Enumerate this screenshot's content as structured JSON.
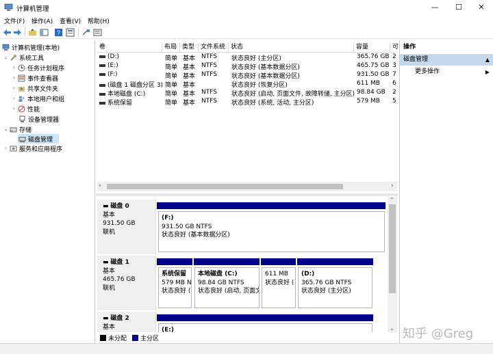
{
  "window": {
    "title": "计算机管理",
    "minimize": "—",
    "maximize": "☐",
    "close": "✕"
  },
  "menu": [
    "文件(F)",
    "操作(A)",
    "查看(V)",
    "帮助(H)"
  ],
  "tree": {
    "root": "计算机管理(本地)",
    "system_tools": "系统工具",
    "items": [
      "任务计划程序",
      "事件查看器",
      "共享文件夹",
      "本地用户和组",
      "性能",
      "设备管理器"
    ],
    "storage": "存储",
    "disk_mgmt": "磁盘管理",
    "services": "服务和应用程序"
  },
  "volumes": {
    "columns": [
      "卷",
      "布局",
      "类型",
      "文件系统",
      "状态",
      "容量",
      "可"
    ],
    "rows": [
      {
        "name": "(D:)",
        "layout": "简单",
        "type": "基本",
        "fs": "NTFS",
        "status": "状态良好 (主分区)",
        "capacity": "365.76 GB",
        "free": "2"
      },
      {
        "name": "(E:)",
        "layout": "简单",
        "type": "基本",
        "fs": "NTFS",
        "status": "状态良好 (基本数据分区)",
        "capacity": "465.75 GB",
        "free": "3"
      },
      {
        "name": "(F:)",
        "layout": "简单",
        "type": "基本",
        "fs": "NTFS",
        "status": "状态良好 (基本数据分区)",
        "capacity": "931.50 GB",
        "free": "7"
      },
      {
        "name": "(磁盘 1 磁盘分区 3)",
        "layout": "简单",
        "type": "基本",
        "fs": "",
        "status": "状态良好 (恢复分区)",
        "capacity": "611 MB",
        "free": "6"
      },
      {
        "name": "本地磁盘 (C:)",
        "layout": "简单",
        "type": "基本",
        "fs": "NTFS",
        "status": "状态良好 (启动, 页面文件, 故障转储, 主分区)",
        "capacity": "98.84 GB",
        "free": "2"
      },
      {
        "name": "系统保留",
        "layout": "简单",
        "type": "基本",
        "fs": "NTFS",
        "status": "状态良好 (系统, 活动, 主分区)",
        "capacity": "579 MB",
        "free": "5"
      }
    ]
  },
  "disks": {
    "d0": {
      "name": "磁盘 0",
      "type": "基本",
      "size": "931.50 GB",
      "state": "联机",
      "p1": {
        "label": "(F:)",
        "size": "931.50 GB NTFS",
        "status": "状态良好 (基本数据分区)"
      }
    },
    "d1": {
      "name": "磁盘 1",
      "type": "基本",
      "size": "465.76 GB",
      "state": "联机",
      "p1": {
        "label": "系统保留",
        "size": "579 MB N",
        "status": "状态良好 ("
      },
      "p2": {
        "label": "本地磁盘 (C:)",
        "size": "98.84 GB NTFS",
        "status": "状态良好 (启动, 页面文"
      },
      "p3": {
        "label": "",
        "size": "611 MB",
        "status": "状态良好 ("
      },
      "p4": {
        "label": "(D:)",
        "size": "365.76 GB NTFS",
        "status": "状态良好 (主分区)"
      }
    },
    "d2": {
      "name": "磁盘 2",
      "type": "基本",
      "p1": {
        "label": "(E:)"
      }
    }
  },
  "legend": {
    "unallocated": "未分配",
    "primary": "主分区"
  },
  "actions": {
    "header": "操作",
    "section": "磁盘管理",
    "more": "更多操作"
  },
  "watermark": "知乎 @Greg",
  "colors": {
    "partition_bar": "#00008b",
    "unallocated": "#000000",
    "selected": "#cce4f7",
    "actions_section": "#c5d9ec"
  }
}
